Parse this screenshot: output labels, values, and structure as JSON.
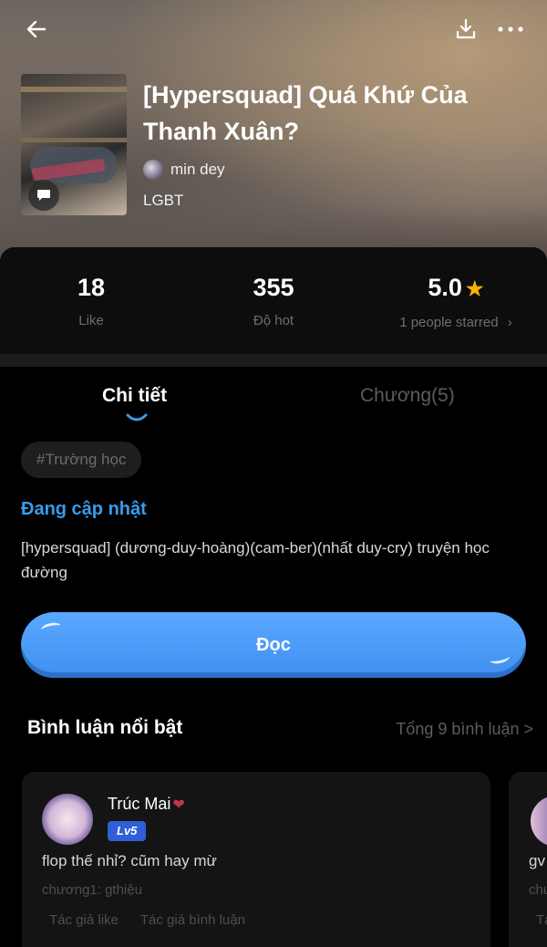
{
  "story": {
    "title": "[Hypersquad] Quá Khứ Của Thanh Xuân?",
    "author": "min dey",
    "genre": "LGBT"
  },
  "stats": {
    "likes": {
      "value": "18",
      "label": "Like"
    },
    "hot": {
      "value": "355",
      "label": "Độ hot"
    },
    "rating": {
      "value": "5.0",
      "label": "1 people starred"
    }
  },
  "tabs": [
    {
      "label": "Chi tiết",
      "active": true
    },
    {
      "label": "Chương(5)",
      "active": false
    }
  ],
  "tag": "#Trường học",
  "status": "Đang cập nhật",
  "description": "[hypersquad] (dương-duy-hoàng)(cam-ber)(nhất duy-cry) truyện học đường",
  "read_button": "Đọc",
  "comments": {
    "heading": "Bình luận nổi bật",
    "total": "Tổng 9 bình luận >",
    "items": [
      {
        "user": "Trúc Mai",
        "level": "Lv5",
        "text": "flop thế nhỉ? cũm hay mừ",
        "chapter": "chương1: gthiệu",
        "actions": [
          "Tác giả like",
          "Tác giả bình luận"
        ]
      },
      {
        "text": "gv",
        "chapter": "chư",
        "action": "Tá"
      }
    ]
  },
  "colors": {
    "accent_blue": "#3a9bec",
    "button_blue": "#4a9af6",
    "star_gold": "#f5b400",
    "level_badge": "#2f5ed6"
  },
  "icons": [
    "back-arrow-icon",
    "download-icon",
    "more-icon",
    "chat-bubble-icon",
    "star-icon",
    "heart-icon"
  ]
}
